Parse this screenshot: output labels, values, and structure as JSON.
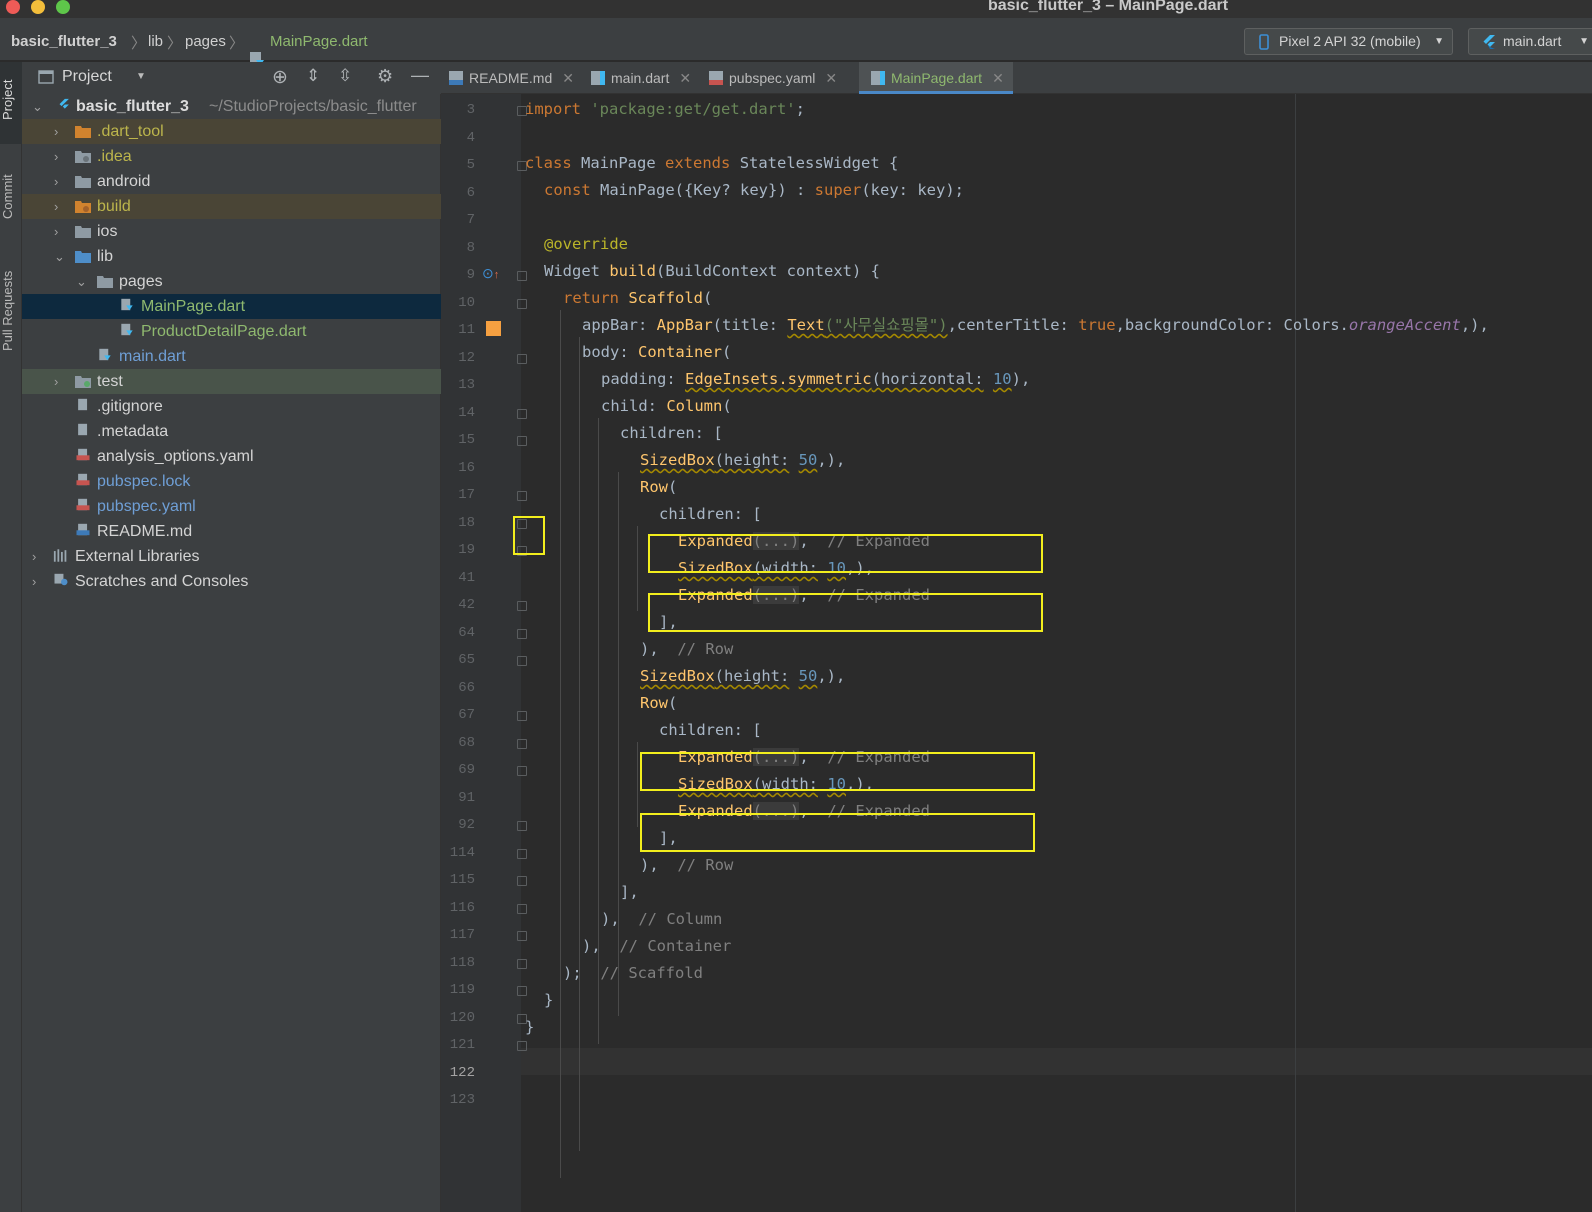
{
  "window": {
    "title": "basic_flutter_3 – MainPage.dart"
  },
  "breadcrumb": [
    "basic_flutter_3",
    "lib",
    "pages",
    "MainPage.dart"
  ],
  "toolbar": {
    "device": "Pixel 2 API 32 (mobile)",
    "run_config": "main.dart"
  },
  "side_tabs": [
    "Project",
    "Commit",
    "Pull Requests"
  ],
  "project_panel": {
    "title": "Project",
    "root": {
      "name": "basic_flutter_3",
      "path": "~/StudioProjects/basic_flutter"
    },
    "items": [
      {
        "label": ".dart_tool"
      },
      {
        "label": ".idea"
      },
      {
        "label": "android"
      },
      {
        "label": "build"
      },
      {
        "label": "ios"
      },
      {
        "label": "lib"
      },
      {
        "label": "pages"
      },
      {
        "label": "MainPage.dart"
      },
      {
        "label": "ProductDetailPage.dart"
      },
      {
        "label": "main.dart"
      },
      {
        "label": "test"
      },
      {
        "label": ".gitignore"
      },
      {
        "label": ".metadata"
      },
      {
        "label": "analysis_options.yaml"
      },
      {
        "label": "pubspec.lock"
      },
      {
        "label": "pubspec.yaml"
      },
      {
        "label": "README.md"
      },
      {
        "label": "External Libraries"
      },
      {
        "label": "Scratches and Consoles"
      }
    ]
  },
  "tabs": [
    {
      "label": "README.md",
      "active": false
    },
    {
      "label": "main.dart",
      "active": false
    },
    {
      "label": "pubspec.yaml",
      "active": false
    },
    {
      "label": "MainPage.dart",
      "active": true
    }
  ],
  "code": {
    "line_numbers": [
      "3",
      "4",
      "5",
      "6",
      "7",
      "8",
      "9",
      "10",
      "11",
      "12",
      "13",
      "14",
      "15",
      "16",
      "17",
      "18",
      "19",
      "41",
      "42",
      "64",
      "65",
      "66",
      "67",
      "68",
      "69",
      "91",
      "92",
      "114",
      "115",
      "116",
      "117",
      "118",
      "119",
      "120",
      "121",
      "122",
      "123"
    ],
    "lines": {
      "l3": {
        "kw": "import",
        "str": "'package:get/get.dart'",
        "tail": ";"
      },
      "l5": {
        "kw1": "class",
        "name": "MainPage",
        "kw2": "extends",
        "base": "StatelessWidget",
        "tail": "{"
      },
      "l6": {
        "kw": "const",
        "rest": "MainPage({Key? key}) :",
        "kw2": "super",
        "tail": "(key: key);"
      },
      "l8": {
        "ann": "@override"
      },
      "l9": {
        "type": "Widget",
        "fn": "build",
        "tail": "(BuildContext context) {"
      },
      "l10": {
        "kw": "return",
        "cls": "Scaffold",
        "tail": "("
      },
      "l11": {
        "p1": "appBar:",
        "c1": "AppBar",
        "p2": "(title:",
        "c2": "Text",
        "str": "(\"사무실쇼핑몰\")",
        "p3": ",centerTitle:",
        "kw": "true",
        "p4": ",backgroundColor: Colors.",
        "ital": "orangeAccent",
        "p5": ",),"
      },
      "l12": {
        "p": "body:",
        "cls": "Container",
        "tail": "("
      },
      "l13": {
        "p": "padding:",
        "cls": "EdgeInsets.symmetric",
        "p2": "(horizontal:",
        "num": "10",
        "tail": "),"
      },
      "l14": {
        "p": "child:",
        "cls": "Column",
        "tail": "("
      },
      "l15": {
        "p": "children: ["
      },
      "l16": {
        "cls": "SizedBox",
        "p": "(height:",
        "num": "50",
        "tail": ",),"
      },
      "l17": {
        "cls": "Row",
        "tail": "("
      },
      "l18": {
        "p": "children: ["
      },
      "l19": {
        "cls": "Expanded",
        "fold": "(...)",
        "tail": ",",
        "cmt": "// Expanded"
      },
      "l41": {
        "cls": "SizedBox",
        "p": "(width:",
        "num": "10",
        "tail": ",),"
      },
      "l42": {
        "cls": "Expanded",
        "fold": "(...)",
        "tail": ",",
        "cmt": "// Expanded"
      },
      "l64": {
        "p": "],"
      },
      "l65": {
        "p": "),",
        "cmt": "// Row"
      },
      "l66": {
        "cls": "SizedBox",
        "p": "(height:",
        "num": "50",
        "tail": ",),"
      },
      "l67": {
        "cls": "Row",
        "tail": "("
      },
      "l68": {
        "p": "children: ["
      },
      "l69": {
        "cls": "Expanded",
        "fold": "(...)",
        "tail": ",",
        "cmt": "// Expanded"
      },
      "l91": {
        "cls": "SizedBox",
        "p": "(width:",
        "num": "10",
        "tail": ",),"
      },
      "l92": {
        "cls": "Expanded",
        "fold": "(...)",
        "tail": ",",
        "cmt": "// Expanded"
      },
      "l114": {
        "p": "],"
      },
      "l115": {
        "p": "),",
        "cmt": "// Row"
      },
      "l116": {
        "p": "],"
      },
      "l117": {
        "p": "),",
        "cmt": "// Column"
      },
      "l118": {
        "p": "),",
        "cmt": "// Container"
      },
      "l119": {
        "p": ");",
        "cmt": "// Scaffold"
      },
      "l120": {
        "p": "}"
      },
      "l121": {
        "p": "}"
      }
    }
  },
  "colors": {
    "highlight_box": "#f2ee1d",
    "selection": "#0d293e",
    "excluded_folder_bg": "#4a4536",
    "test_folder_bg": "#49544a"
  }
}
